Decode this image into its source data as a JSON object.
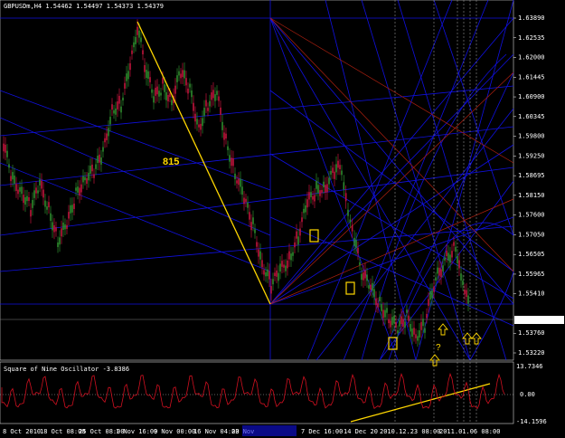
{
  "window": {
    "symbol_header": "GBPUSDm,H4  1.54462  1.54497  1.54373  1.54379"
  },
  "colors": {
    "background": "#000000",
    "grid_blue": "#1010e0",
    "grid_red": "#b02010",
    "candle_up": "#2e8b2e",
    "candle_down": "#c0143c",
    "trendline": "#ffd700",
    "oscillator_line": "#d01020",
    "osc_dotted": "#c0c0c0",
    "current_price_box": "#ffffff",
    "vertical_dotted": "#909090"
  },
  "price_axis": {
    "ticks": [
      "1.63890",
      "1.62535",
      "1.62000",
      "1.61445",
      "1.60900",
      "1.60345",
      "1.59800",
      "1.59250",
      "1.58695",
      "1.58150",
      "1.57600",
      "1.57050",
      "1.56505",
      "1.55965",
      "1.55410",
      "1.54379",
      "1.53760",
      "1.53220"
    ],
    "current": "1.54379"
  },
  "time_axis": {
    "labels": [
      "8 Oct 2010",
      "18 Oct 08:00",
      "25 Oct 08:00",
      "1 Nov 16:00",
      "9 Nov 00:00",
      "16 Nov 04:00",
      "23 Nov",
      "7 Dec 16:00",
      "14 Dec 20",
      "2010.12.23 08:00",
      "2011.01.06 08:00"
    ]
  },
  "annotations": {
    "label_815": "815",
    "question_mark": "?"
  },
  "oscillator": {
    "title": "Square of Nine Oscillator -3.8386",
    "ticks": [
      "13.7346",
      "0.00",
      "-14.1596"
    ]
  }
}
